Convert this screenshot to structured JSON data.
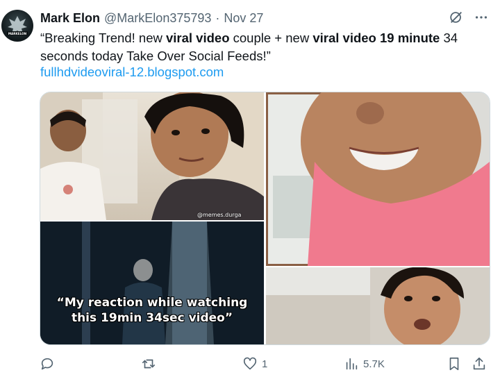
{
  "tweet": {
    "author_name": "Mark Elon",
    "handle": "@MarkElon375793",
    "separator": "·",
    "date": "Nov 27",
    "avatar_text": "MARKELON",
    "text_parts": [
      {
        "t": "“Breaking Trend! new ",
        "b": false
      },
      {
        "t": "viral video",
        "b": true
      },
      {
        "t": " couple + new ",
        "b": false
      },
      {
        "t": "viral video 19 minute",
        "b": true
      },
      {
        "t": " 34 seconds today Take Over Social Feeds!”",
        "b": false
      }
    ],
    "link": "fullhdvideoviral-12.blogspot.com"
  },
  "media": {
    "watermark": "@memes.durga",
    "caption_line1": "“My reaction while watching",
    "caption_line2": "this 19min 34sec video”"
  },
  "actions": {
    "reply_count": "",
    "retweet_count": "",
    "like_count": "1",
    "views_count": "5.7K"
  },
  "icons": {
    "grok": "grok-icon",
    "more": "more-icon",
    "reply": "reply-icon",
    "retweet": "retweet-icon",
    "like": "heart-icon",
    "views": "views-icon",
    "bookmark": "bookmark-icon",
    "share": "share-icon"
  },
  "colors": {
    "link": "#1d9bf0",
    "muted": "#536471",
    "text": "#0f1419"
  }
}
